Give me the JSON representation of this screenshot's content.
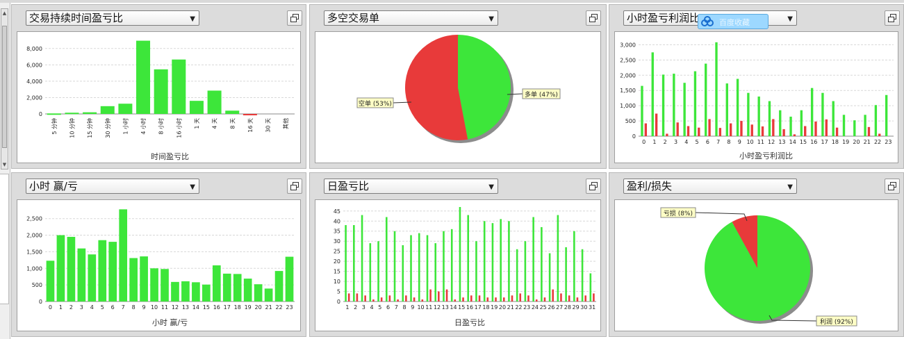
{
  "panels": [
    {
      "id": "p1",
      "title": "交易持续时间盈亏比"
    },
    {
      "id": "p2",
      "title": "多空交易单"
    },
    {
      "id": "p3",
      "title": "小时盈亏利润比"
    },
    {
      "id": "p4",
      "title": "小时 赢/亏"
    },
    {
      "id": "p5",
      "title": "日盈亏比"
    },
    {
      "id": "p6",
      "title": "盈利/损失"
    }
  ],
  "overlay_widget": {
    "text": "百度收藏"
  },
  "colors": {
    "win": "#3de63a",
    "loss": "#e83a3a",
    "panel": "#dcdcdc",
    "tooltip": "#ffffc6"
  },
  "chart_data": [
    {
      "type": "bar",
      "xlabel": "时间盈亏比",
      "ylim": [
        0,
        9000
      ],
      "yticks": [
        0,
        2000,
        4000,
        6000,
        8000
      ],
      "ytick_labels": [
        "0",
        "2,000",
        "4,000",
        "6,000",
        "8,000"
      ],
      "categories": [
        "5 分钟",
        "10 分钟",
        "15 分钟",
        "30 分钟",
        "1 小时",
        "4 小时",
        "8 小时",
        "16 小时",
        "1 天",
        "4 天",
        "8 天",
        "16 天",
        "30 天",
        "其他"
      ],
      "values": [
        60,
        150,
        200,
        950,
        1250,
        8950,
        5450,
        6650,
        1600,
        2850,
        400,
        -120,
        0,
        0
      ]
    },
    {
      "type": "pie",
      "slices": [
        {
          "label": "空单 (53%)",
          "value": 53,
          "color": "#e83a3a"
        },
        {
          "label": "多单 (47%)",
          "value": 47,
          "color": "#3de63a"
        }
      ]
    },
    {
      "type": "bar",
      "xlabel": "小时盈亏利润比",
      "ylim": [
        0,
        3100
      ],
      "yticks": [
        0,
        500,
        1000,
        1500,
        2000,
        2500,
        3000
      ],
      "ytick_labels": [
        "0",
        "500",
        "1,000",
        "1,500",
        "2,000",
        "2,500",
        "3,000"
      ],
      "categories": [
        "0",
        "1",
        "2",
        "3",
        "4",
        "5",
        "6",
        "7",
        "8",
        "9",
        "10",
        "11",
        "12",
        "13",
        "14",
        "15",
        "16",
        "17",
        "18",
        "19",
        "20",
        "21",
        "22",
        "23"
      ],
      "series": [
        {
          "values": [
            1650,
            2750,
            2020,
            2050,
            1750,
            2130,
            2380,
            3080,
            1730,
            1880,
            1420,
            1300,
            1150,
            850,
            640,
            850,
            1580,
            1420,
            1150,
            700,
            520,
            700,
            1020,
            1350
          ],
          "color": "#3de63a"
        },
        {
          "values": [
            420,
            740,
            80,
            450,
            330,
            280,
            560,
            270,
            420,
            500,
            380,
            320,
            560,
            230,
            60,
            330,
            480,
            550,
            280,
            0,
            0,
            300,
            80,
            0
          ],
          "color": "#e83a3a"
        }
      ]
    },
    {
      "type": "bar",
      "xlabel": "小时 赢/亏",
      "ylim": [
        0,
        2850
      ],
      "yticks": [
        0,
        500,
        1000,
        1500,
        2000,
        2500
      ],
      "ytick_labels": [
        "0",
        "500",
        "1,000",
        "1,500",
        "2,000",
        "2,500"
      ],
      "categories": [
        "0",
        "1",
        "2",
        "3",
        "4",
        "5",
        "6",
        "7",
        "8",
        "9",
        "10",
        "11",
        "12",
        "13",
        "14",
        "15",
        "16",
        "17",
        "18",
        "19",
        "20",
        "21",
        "22",
        "23"
      ],
      "values": [
        1230,
        2000,
        1950,
        1600,
        1420,
        1850,
        1800,
        2780,
        1310,
        1360,
        1000,
        980,
        590,
        610,
        580,
        510,
        1090,
        840,
        830,
        690,
        520,
        390,
        920,
        1350
      ]
    },
    {
      "type": "bar",
      "xlabel": "日盈亏比",
      "ylim": [
        0,
        47
      ],
      "yticks": [
        0,
        5,
        10,
        15,
        20,
        25,
        30,
        35,
        40,
        45
      ],
      "ytick_labels": [
        "0",
        "5",
        "10",
        "15",
        "20",
        "25",
        "30",
        "35",
        "40",
        "45"
      ],
      "categories": [
        "1",
        "2",
        "3",
        "4",
        "5",
        "6",
        "7",
        "8",
        "9",
        "10",
        "11",
        "12",
        "13",
        "14",
        "15",
        "16",
        "17",
        "18",
        "19",
        "20",
        "21",
        "22",
        "23",
        "24",
        "25",
        "26",
        "27",
        "28",
        "29",
        "30",
        "31"
      ],
      "series": [
        {
          "values": [
            38,
            38,
            43,
            29,
            30,
            42,
            35,
            28,
            33,
            34,
            33,
            29,
            35,
            36,
            47,
            43,
            30,
            40,
            39,
            41,
            40,
            26,
            30,
            42,
            37,
            24,
            43,
            27,
            35,
            26,
            14
          ],
          "color": "#3de63a"
        },
        {
          "values": [
            4,
            4,
            3,
            1,
            2,
            3,
            1,
            3,
            2,
            1,
            6,
            5,
            6,
            1,
            2,
            3,
            3,
            2,
            2,
            2,
            3,
            4,
            3,
            1,
            2,
            6,
            4,
            3,
            2,
            3,
            4
          ],
          "color": "#e83a3a"
        }
      ]
    },
    {
      "type": "pie",
      "slices": [
        {
          "label": "亏损 (8%)",
          "value": 8,
          "color": "#e83a3a"
        },
        {
          "label": "利润 (92%)",
          "value": 92,
          "color": "#3de63a"
        }
      ]
    }
  ]
}
